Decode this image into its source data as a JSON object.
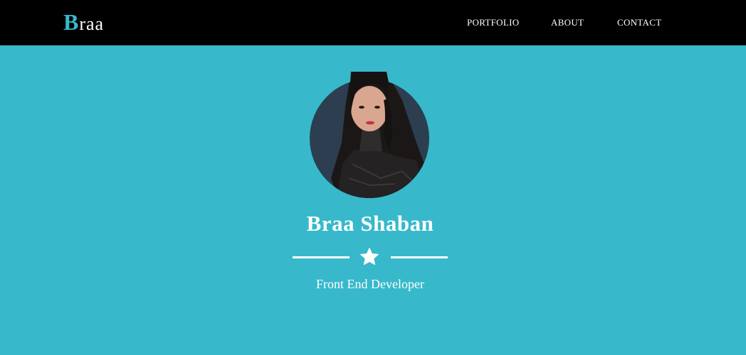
{
  "navbar": {
    "brand": {
      "initial": "B",
      "rest": "raa"
    },
    "links": [
      {
        "label": "PORTFOLIO"
      },
      {
        "label": "ABOUT"
      },
      {
        "label": "CONTACT"
      }
    ]
  },
  "hero": {
    "avatar_icon": "profile-photo",
    "name": "Braa Shaban",
    "divider_icon": "star-icon",
    "role": "Front End Developer"
  },
  "colors": {
    "accent": "#37b9cb",
    "navbar_bg": "#000000",
    "avatar_bg": "#2c3e50",
    "text": "#ffffff"
  }
}
